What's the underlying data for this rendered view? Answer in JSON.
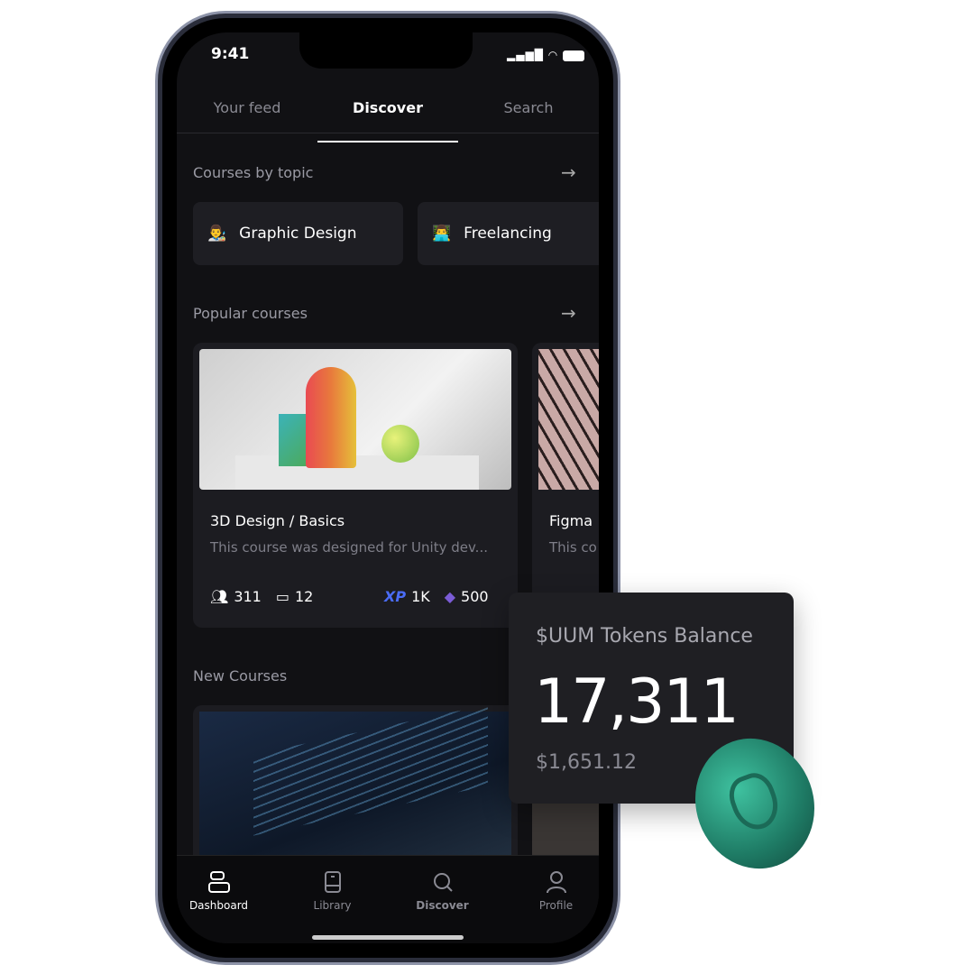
{
  "status": {
    "time": "9:41"
  },
  "tabs": [
    {
      "label": "Your feed"
    },
    {
      "label": "Discover",
      "active": true
    },
    {
      "label": "Search"
    }
  ],
  "topics": {
    "title": "Courses by topic",
    "items": [
      {
        "emoji": "👨‍🎨",
        "label": "Graphic Design"
      },
      {
        "emoji": "👨‍💻",
        "label": "Freelancing"
      }
    ]
  },
  "popular": {
    "title": "Popular courses",
    "courses": [
      {
        "title": "3D Design / Basics",
        "desc": "This course was designed for Unity dev...",
        "students": "311",
        "lessons": "12",
        "xp_label": "XP",
        "xp": "1K",
        "gems": "500"
      },
      {
        "title": "Figma",
        "desc": "This co"
      }
    ]
  },
  "new_courses": {
    "title": "New Courses"
  },
  "nav": [
    {
      "label": "Dashboard",
      "icon": "dashboard-icon",
      "active": true
    },
    {
      "label": "Library",
      "icon": "book-icon"
    },
    {
      "label": "Discover",
      "icon": "search-icon"
    },
    {
      "label": "Profile",
      "icon": "user-icon"
    }
  ],
  "tokens": {
    "title": "$UUM Tokens Balance",
    "balance": "17,311",
    "usd": "$1,651.12"
  },
  "colors": {
    "accent_xp": "#4a6cf7",
    "gem": "#7b5cd6",
    "coin": "#2fa58a"
  }
}
